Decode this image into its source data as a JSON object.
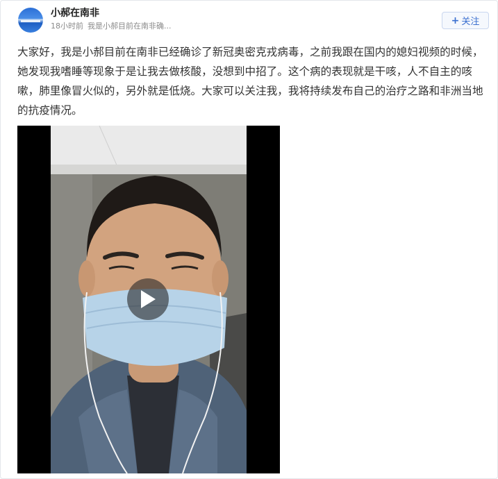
{
  "post": {
    "author": "小郝在南非",
    "time": "18小时前",
    "source": "我是小郝目前在南非确...",
    "follow_label": "关注",
    "text": "大家好，我是小郝目前在南非已经确诊了新冠奥密克戎病毒，之前我跟在国内的媳妇视频的时候，她发现我嗜睡等现象于是让我去做核酸，没想到中招了。这个病的表现就是干咳，人不自主的咳嗽，肺里像冒火似的，另外就是低烧。大家可以关注我，我将持续发布自己的治疗之路和非洲当地的抗疫情况。"
  },
  "icons": {
    "follow": "plus-icon",
    "video": "play-icon"
  },
  "colors": {
    "accent": "#3a6fd0",
    "meta": "#8a8a8a",
    "text": "#333333"
  }
}
